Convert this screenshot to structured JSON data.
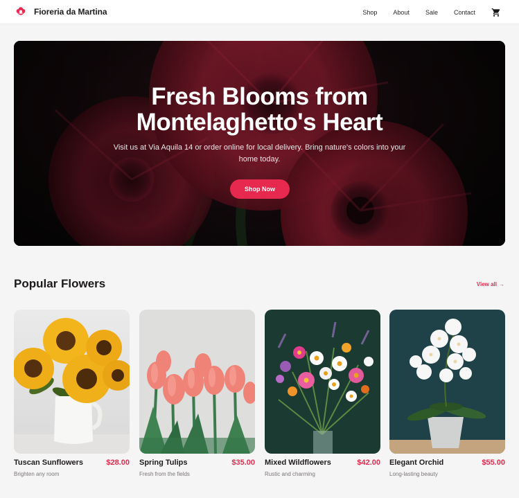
{
  "nav": {
    "brand_name": "Fioreria da Martina",
    "brand_icon": "flower-icon",
    "links": [
      "Shop",
      "About",
      "Sale",
      "Contact"
    ],
    "cart_icon": "cart-icon"
  },
  "hero": {
    "title": "Fresh Blooms from Montelaghetto's Heart",
    "subtitle": "Visit us at Via Aquila 14 or order online for local delivery. Bring nature's colors into your home today.",
    "cta_label": "Shop Now"
  },
  "section": {
    "title": "Popular Flowers",
    "view_all_label": "View all",
    "view_all_arrow": "→"
  },
  "products": [
    {
      "name": "Tuscan Sunflowers",
      "price": "$28.00",
      "desc": "Brighten any room"
    },
    {
      "name": "Spring Tulips",
      "price": "$35.00",
      "desc": "Fresh from the fields"
    },
    {
      "name": "Mixed Wildflowers",
      "price": "$42.00",
      "desc": "Rustic and charming"
    },
    {
      "name": "Elegant Orchid",
      "price": "$55.00",
      "desc": "Long-lasting beauty"
    }
  ],
  "colors": {
    "accent": "#e8294f",
    "price": "#e22b4f",
    "background": "#f6f5f5"
  }
}
